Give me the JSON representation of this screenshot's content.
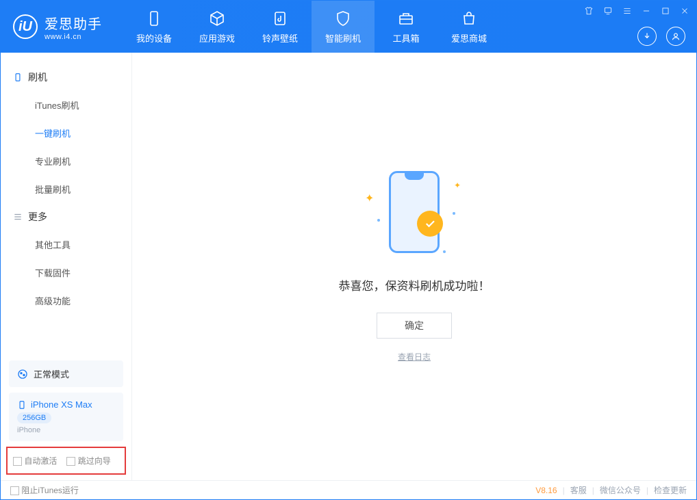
{
  "app": {
    "name": "爱思助手",
    "url": "www.i4.cn"
  },
  "tabs": [
    {
      "label": "我的设备"
    },
    {
      "label": "应用游戏"
    },
    {
      "label": "铃声壁纸"
    },
    {
      "label": "智能刷机"
    },
    {
      "label": "工具箱"
    },
    {
      "label": "爱思商城"
    }
  ],
  "sidebar": {
    "group1": {
      "title": "刷机",
      "items": [
        "iTunes刷机",
        "一键刷机",
        "专业刷机",
        "批量刷机"
      ]
    },
    "group2": {
      "title": "更多",
      "items": [
        "其他工具",
        "下载固件",
        "高级功能"
      ]
    },
    "mode": "正常模式",
    "device": {
      "name": "iPhone XS Max",
      "storage": "256GB",
      "type": "iPhone"
    },
    "checkboxes": {
      "auto_activate": "自动激活",
      "skip_guide": "跳过向导"
    }
  },
  "main": {
    "success": "恭喜您，保资料刷机成功啦！",
    "ok": "确定",
    "log": "查看日志"
  },
  "footer": {
    "block_itunes": "阻止iTunes运行",
    "version": "V8.16",
    "support": "客服",
    "wechat": "微信公众号",
    "update": "检查更新"
  }
}
